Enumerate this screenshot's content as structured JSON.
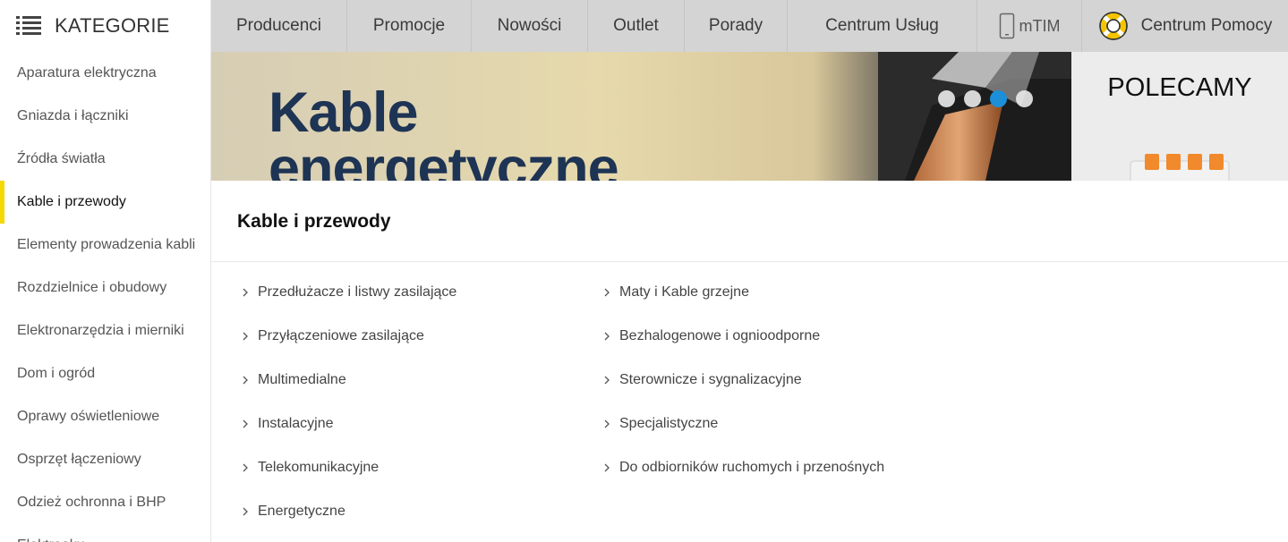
{
  "sidebar": {
    "title": "KATEGORIE",
    "icon": "list-menu-icon",
    "active_color": "#f5d800",
    "items": [
      {
        "label": "Aparatura elektryczna"
      },
      {
        "label": "Gniazda i łączniki"
      },
      {
        "label": "Źródła światła"
      },
      {
        "label": "Kable i przewody",
        "active": true
      },
      {
        "label": "Elementy prowadzenia kabli"
      },
      {
        "label": "Rozdzielnice i obudowy"
      },
      {
        "label": "Elektronarzędzia i mierniki"
      },
      {
        "label": "Dom i ogród"
      },
      {
        "label": "Oprawy oświetleniowe"
      },
      {
        "label": "Osprzęt łączeniowy"
      },
      {
        "label": "Odzież ochronna i BHP"
      },
      {
        "label": "Elektroaku..."
      }
    ]
  },
  "topnav": {
    "items": [
      {
        "label": "Producenci"
      },
      {
        "label": "Promocje"
      },
      {
        "label": "Nowości"
      },
      {
        "label": "Outlet"
      },
      {
        "label": "Porady"
      },
      {
        "label": "Centrum Usług"
      }
    ],
    "mtim": {
      "label": "mTIM",
      "icon": "phone-icon"
    },
    "help": {
      "label": "Centrum Pomocy",
      "icon": "lifebuoy-icon"
    }
  },
  "banner": {
    "title_line1": "Kable",
    "title_line2": "energetyczne",
    "slides": 4,
    "active_slide": 3,
    "accent_color": "#1d8fd9"
  },
  "polecamy": {
    "title": "POLECAMY"
  },
  "content": {
    "title": "Kable i przewody",
    "col1": [
      {
        "label": "Przedłużacze i listwy zasilające"
      },
      {
        "label": "Przyłączeniowe zasilające"
      },
      {
        "label": "Multimedialne"
      },
      {
        "label": "Instalacyjne"
      },
      {
        "label": "Telekomunikacyjne"
      },
      {
        "label": "Energetyczne"
      }
    ],
    "col2": [
      {
        "label": "Maty i Kable grzejne"
      },
      {
        "label": "Bezhalogenowe i ognioodporne"
      },
      {
        "label": "Sterownicze i sygnalizacyjne"
      },
      {
        "label": "Specjalistyczne"
      },
      {
        "label": "Do odbiorników ruchomych i przenośnych"
      }
    ]
  }
}
